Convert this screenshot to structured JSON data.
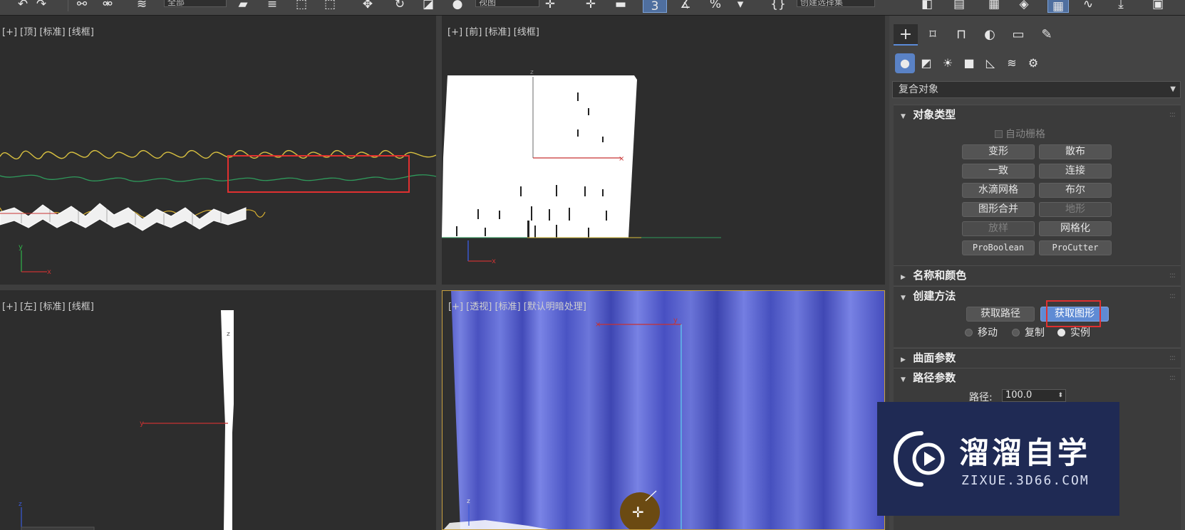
{
  "toolbar": {
    "selection_filter": "全部",
    "reference_coord": "视图",
    "snap_toggle": "3",
    "percent_snap": "%",
    "named_selection": "创建选择集"
  },
  "viewports": {
    "top": "[+] [顶] [标准] [线框]",
    "front": "[+] [前] [标准] [线框]",
    "left": "[+] [左] [标准] [线框]",
    "perspective": "[+] [透视] [标准] [默认明暗处理]"
  },
  "panel": {
    "category_dropdown": "复合对象",
    "rollouts": {
      "object_type": {
        "title": "对象类型",
        "autogrid": "自动栅格",
        "buttons": [
          "变形",
          "散布",
          "一致",
          "连接",
          "水滴网格",
          "布尔",
          "图形合并",
          "地形",
          "放样",
          "网格化",
          "ProBoolean",
          "ProCutter"
        ]
      },
      "name_color": {
        "title": "名称和颜色"
      },
      "creation_method": {
        "title": "创建方法",
        "get_path": "获取路径",
        "get_shape": "获取图形",
        "radio_move": "移动",
        "radio_copy": "复制",
        "radio_instance": "实例"
      },
      "surface_params": {
        "title": "曲面参数"
      },
      "path_params": {
        "title": "路径参数",
        "path_label": "路径:",
        "path_value": "100.0"
      }
    }
  },
  "watermark": {
    "title": "溜溜自学",
    "url": "ZIXUE.3D66.COM"
  },
  "colors": {
    "accent": "#5f8bd4",
    "highlight_box": "#e03030",
    "curtain": "#5560c8",
    "axis_x": "#c83232",
    "axis_y": "#2fb24a",
    "axis_z": "#3a5ad8"
  }
}
